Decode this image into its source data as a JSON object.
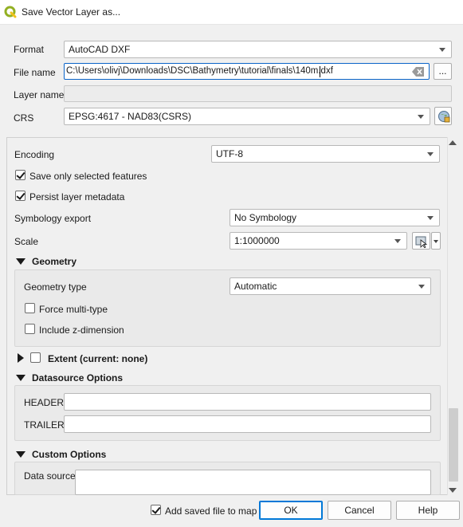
{
  "window": {
    "title": "Save Vector Layer as..."
  },
  "labels": {
    "format": "Format",
    "file_name": "File name",
    "layer_name": "Layer name",
    "crs": "CRS"
  },
  "format": {
    "value": "AutoCAD DXF"
  },
  "file_name": {
    "value": "C:\\Users\\olivj\\Downloads\\DSC\\Bathymetry\\tutorial\\finals\\140m.dxf",
    "browse_label": "..."
  },
  "layer_name": {
    "value": ""
  },
  "crs": {
    "value": "EPSG:4617 - NAD83(CSRS)"
  },
  "encoding": {
    "label": "Encoding",
    "value": "UTF-8"
  },
  "save_only_selected": {
    "label": "Save only selected features",
    "checked": true
  },
  "persist_metadata": {
    "label": "Persist layer metadata",
    "checked": true
  },
  "symbology": {
    "label": "Symbology export",
    "value": "No Symbology"
  },
  "scale": {
    "label": "Scale",
    "value": "1:1000000"
  },
  "geometry": {
    "header": "Geometry",
    "type_label": "Geometry type",
    "type_value": "Automatic",
    "force_multi": "Force multi-type",
    "include_z": "Include z-dimension"
  },
  "extent": {
    "header": "Extent (current: none)"
  },
  "datasource": {
    "header": "Datasource Options",
    "header_label": "HEADER",
    "trailer_label": "TRAILER"
  },
  "custom": {
    "header": "Custom Options",
    "data_source_label": "Data source"
  },
  "footer": {
    "add_saved_label": "Add saved file to map",
    "ok": "OK",
    "cancel": "Cancel",
    "help": "Help"
  },
  "colors": {
    "focus": "#0a64c8",
    "qgis_green": "#93b023"
  }
}
